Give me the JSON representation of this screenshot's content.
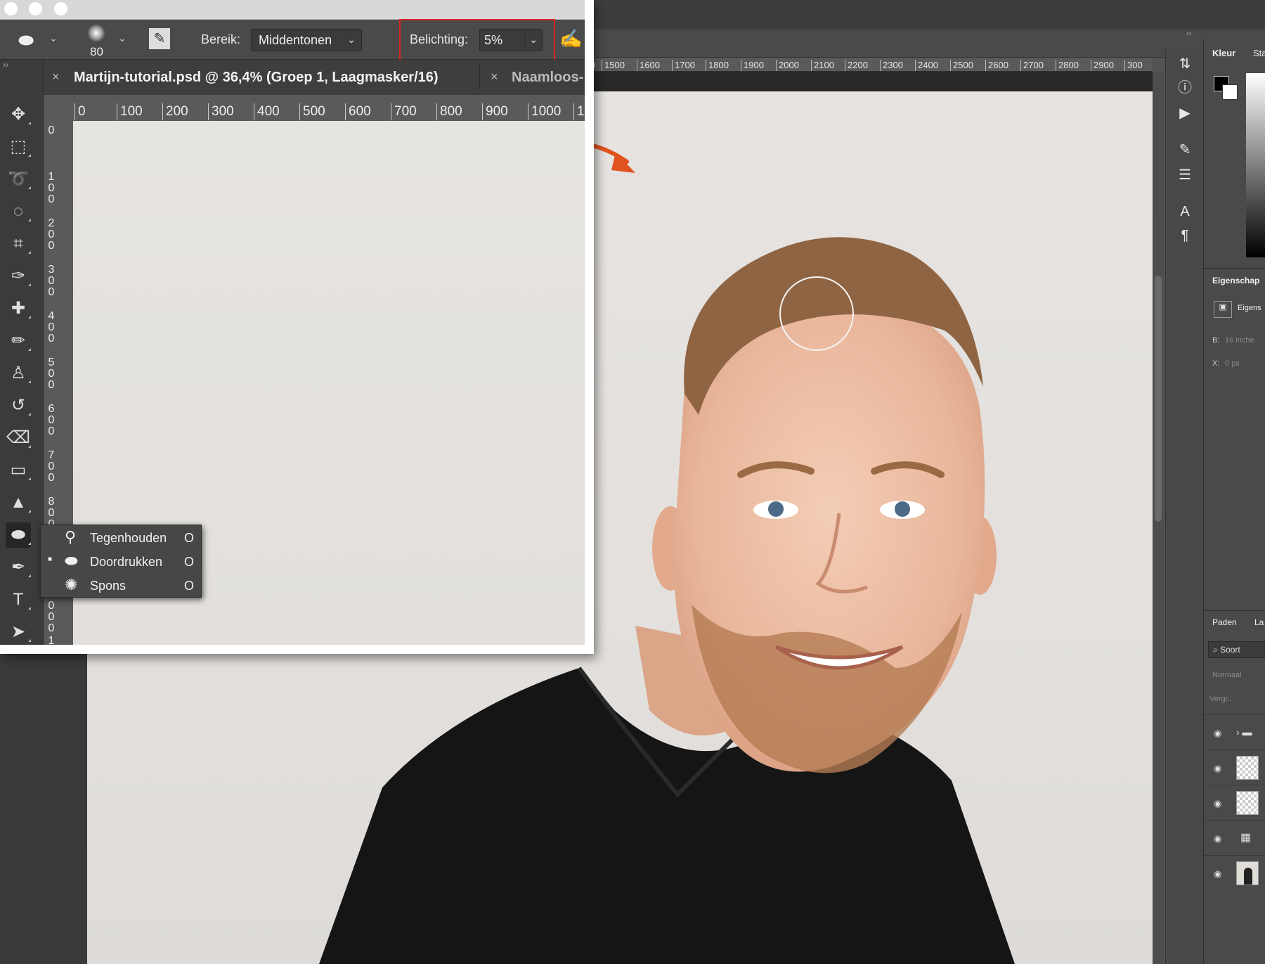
{
  "inset": {
    "brush_size": "80",
    "range_label": "Bereik:",
    "range_value": "Midden­tonen",
    "exposure_label": "Belichting:",
    "exposure_value": "5%",
    "doc_tab_active": "Martijn-tutorial.psd @ 36,4% (Groep 1, Laagmasker/16)",
    "doc_tab_other": "Naamloos-",
    "ruler_top": [
      "0",
      "100",
      "200",
      "300",
      "400",
      "500",
      "600",
      "700",
      "800",
      "900",
      "1000",
      "1"
    ],
    "ruler_left": [
      "0",
      "100",
      "200",
      "300",
      "400",
      "500",
      "600",
      "700",
      "800",
      "900",
      "1000",
      "1"
    ],
    "flyout": [
      {
        "label": "Tegenhouden",
        "shortcut": "O",
        "icon": "burn-icon",
        "selected": false
      },
      {
        "label": "Doordrukken",
        "shortcut": "O",
        "icon": "dodge-icon",
        "selected": true
      },
      {
        "label": "Spons",
        "shortcut": "O",
        "icon": "sponge-icon",
        "selected": false
      }
    ]
  },
  "background": {
    "ruler_top": [
      "0",
      "1500",
      "1600",
      "1700",
      "1800",
      "1900",
      "2000",
      "2100",
      "2200",
      "2300",
      "2400",
      "2500",
      "2600",
      "2700",
      "2800",
      "2900",
      "300"
    ],
    "collapse": "‹‹"
  },
  "right_panel": {
    "tab_color": "Kleur",
    "tab_stal": "Sta",
    "properties_title": "Eigenschap",
    "properties_sub": "Eigens",
    "b_label": "B:",
    "b_value": "16 inche",
    "x_label": "X:",
    "x_value": "0 px",
    "paths_tab": "Paden",
    "layers_tab": "La",
    "search_label": "Soort",
    "blend_mode": "Normaal",
    "lock_label": "Vergr.:"
  },
  "colors": {
    "accent_arrow": "#e0531f",
    "highlight": "#d22222",
    "panel": "#4a4a4a"
  }
}
